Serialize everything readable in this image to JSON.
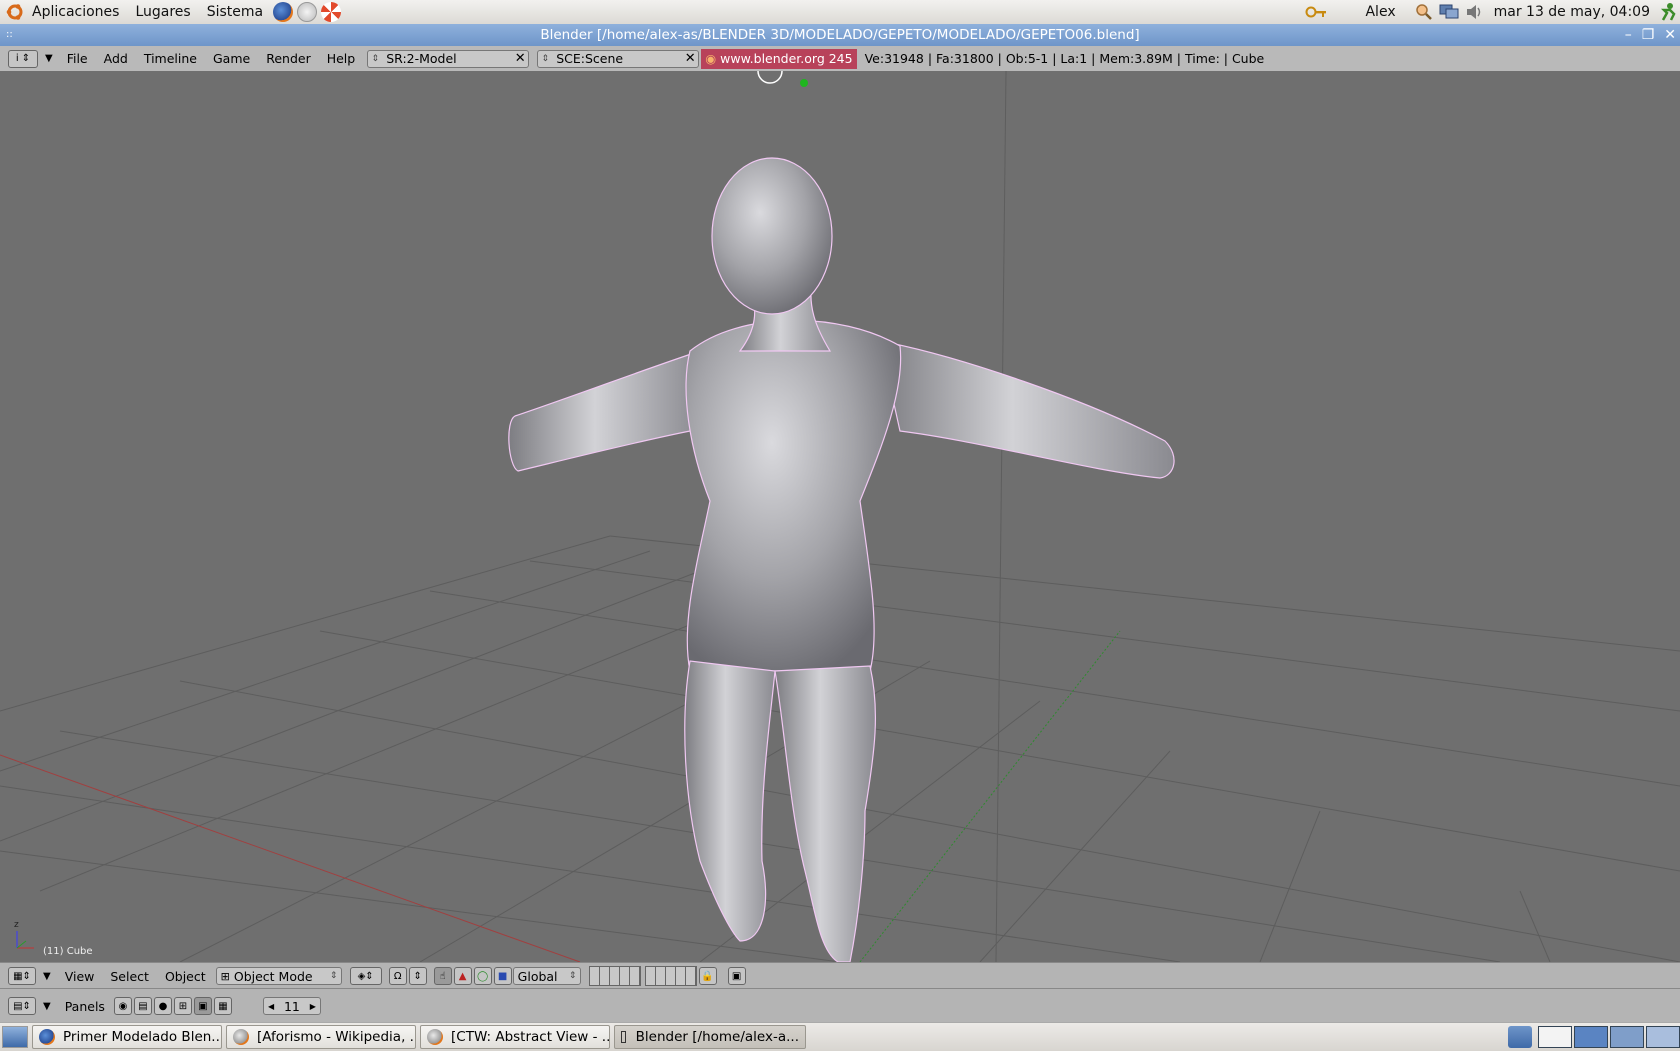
{
  "top_panel": {
    "menus": [
      "Aplicaciones",
      "Lugares",
      "Sistema"
    ],
    "user": "Alex",
    "clock": "mar 13 de may, 04:09"
  },
  "window": {
    "title": "Blender [/home/alex-as/BLENDER 3D/MODELADO/GEPETO/MODELADO/GEPETO06.blend]"
  },
  "blender_header": {
    "menus": [
      "File",
      "Add",
      "Timeline",
      "Game",
      "Render",
      "Help"
    ],
    "screen": "SR:2-Model",
    "scene": "SCE:Scene",
    "version_tag": "www.blender.org 245",
    "stats": "Ve:31948 | Fa:31800 | Ob:5-1 | La:1  | Mem:3.89M  | Time: | Cube"
  },
  "viewport": {
    "object_label": "(11) Cube",
    "axis_z": "z"
  },
  "view3d_header": {
    "menus": [
      "View",
      "Select",
      "Object"
    ],
    "mode": "Object Mode",
    "orientation": "Global"
  },
  "buttons_header": {
    "panels_label": "Panels",
    "frame": "11"
  },
  "taskbar": {
    "tasks": [
      {
        "label": "Primer Modelado Blen...",
        "icon": "firefox-icon"
      },
      {
        "label": "[Aforismo - Wikipedia, ...",
        "icon": "firefox-icon"
      },
      {
        "label": "[CTW: Abstract View - ...",
        "icon": "firefox-icon"
      },
      {
        "label": "Blender [/home/alex-a...",
        "icon": "window-icon"
      }
    ]
  },
  "colors": {
    "panel_bg": "#dcdad5",
    "titlebar": "#7a9fd1",
    "blender_header": "#b9b9b9",
    "viewport_bg": "#6f6f6f",
    "render_tag": "#b8425a",
    "model": "#a9a9ad"
  }
}
